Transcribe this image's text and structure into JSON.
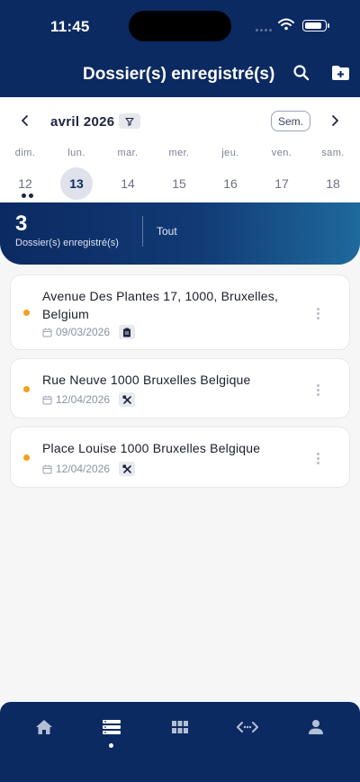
{
  "status_bar": {
    "time": "11:45"
  },
  "header": {
    "title": "Dossier(s) enregistré(s)",
    "search_icon": "search-icon",
    "add_folder_icon": "folder-plus-icon"
  },
  "calendar": {
    "month_label": "avril 2026",
    "view_toggle": "Sem.",
    "days": [
      {
        "dow": "dim.",
        "num": "12"
      },
      {
        "dow": "lun.",
        "num": "13"
      },
      {
        "dow": "mar.",
        "num": "14"
      },
      {
        "dow": "mer.",
        "num": "15"
      },
      {
        "dow": "jeu.",
        "num": "16"
      },
      {
        "dow": "ven.",
        "num": "17"
      },
      {
        "dow": "sam.",
        "num": "18"
      }
    ],
    "selected_day": "13"
  },
  "summary": {
    "count": "3",
    "label": "Dossier(s) enregistré(s)",
    "filter": "Tout"
  },
  "dossiers": [
    {
      "address": "Avenue Des Plantes 17, 1000, Bruxelles, Belgium",
      "date": "09/03/2026",
      "type_icon": "clipboard-icon"
    },
    {
      "address": "Rue Neuve 1000 Bruxelles Belgique",
      "date": "12/04/2026",
      "type_icon": "tools-icon"
    },
    {
      "address": "Place Louise 1000 Bruxelles Belgique",
      "date": "12/04/2026",
      "type_icon": "tools-icon"
    }
  ],
  "colors": {
    "primary": "#0b2a62",
    "status_dot": "#f2a01d",
    "background": "#f6f6f7"
  },
  "bottom_nav": {
    "items": [
      "home-icon",
      "list-icon",
      "grid-icon",
      "code-icon",
      "profile-icon"
    ],
    "active": "list-icon"
  }
}
